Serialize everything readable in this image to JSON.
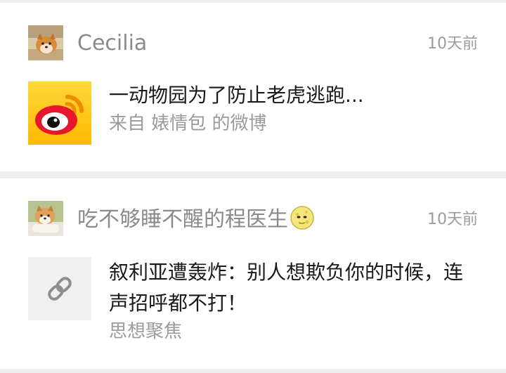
{
  "posts": [
    {
      "author": "Cecilia",
      "time": "10天前",
      "title": "一动物园为了防止老虎逃跑...",
      "source": "来自 婊情包 的微博",
      "avatar_icon": "shiba-dog-avatar-icon",
      "thumb_icon": "weibo-logo-icon"
    },
    {
      "author": "吃不够睡不醒的程医生",
      "author_emoji": "full-moon-face-emoji",
      "time": "10天前",
      "title": "叙利亚遭轰炸：别人想欺负你的时候，连声招呼都不打！",
      "source": "思想聚焦",
      "avatar_icon": "shiba-dog-avatar-icon",
      "thumb_icon": "link-icon"
    }
  ],
  "colors": {
    "background": "#ededed",
    "card": "#ffffff",
    "secondary_text": "#9b9b9b",
    "primary_text": "#1a1a1a",
    "weibo_red": "#e6162d",
    "weibo_yellow": "#ffcc00"
  }
}
